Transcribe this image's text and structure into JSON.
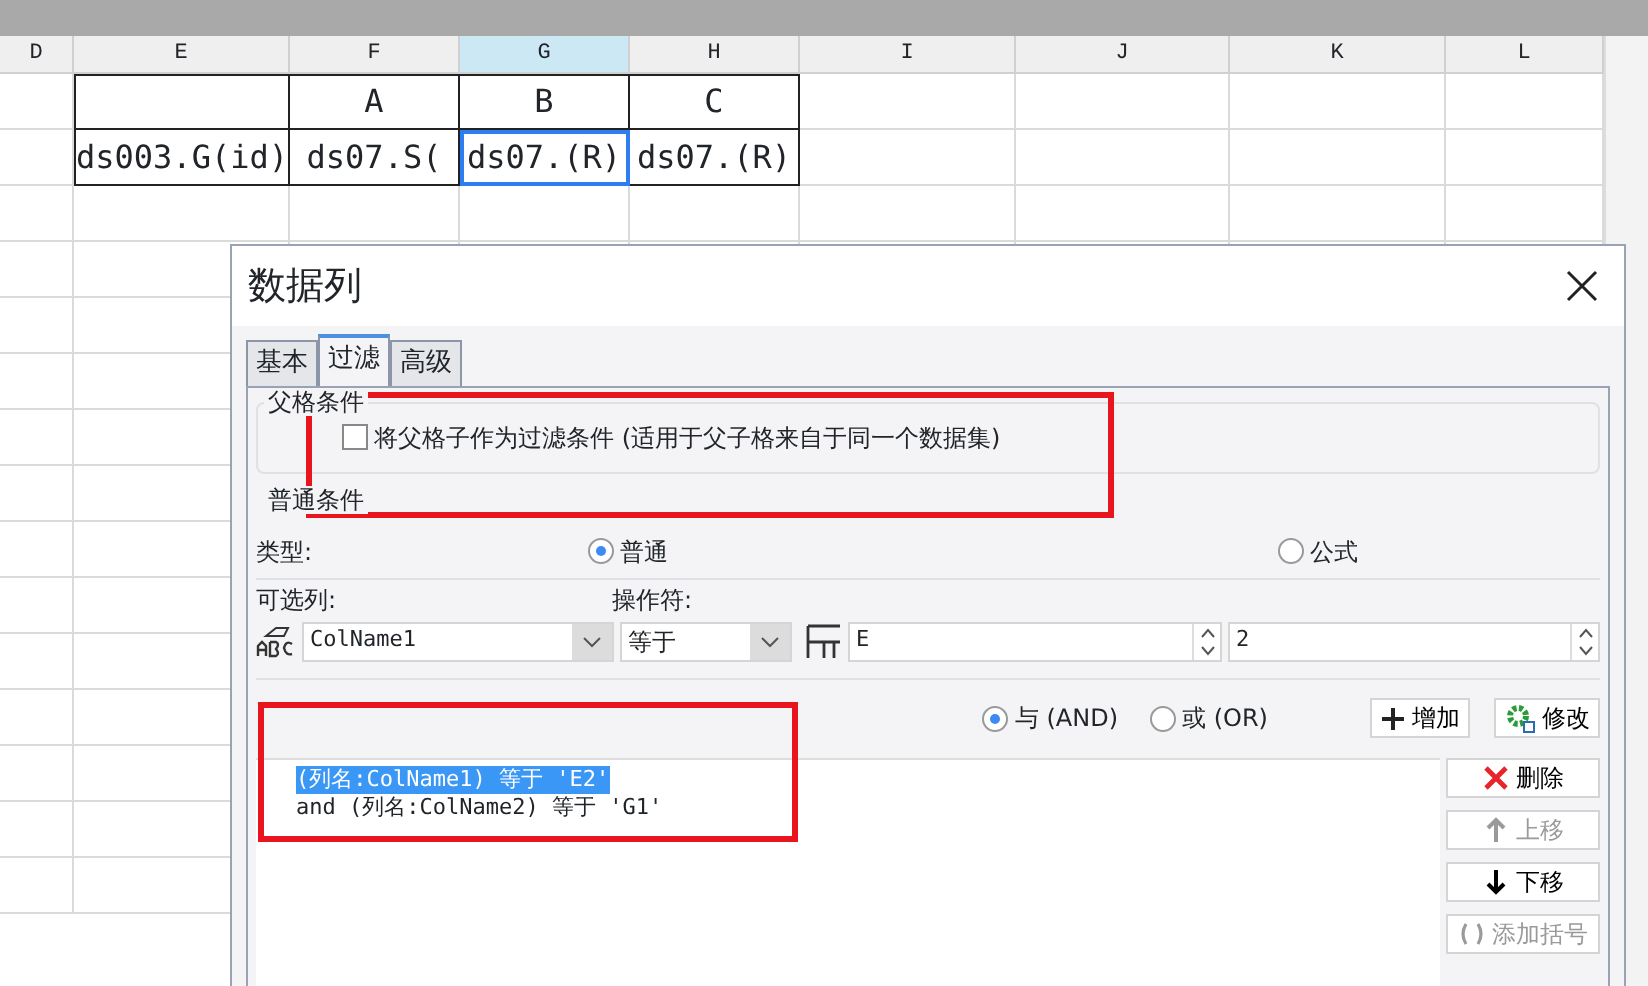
{
  "sheet": {
    "columns": [
      {
        "label": "D",
        "selected": false
      },
      {
        "label": "E",
        "selected": false
      },
      {
        "label": "F",
        "selected": false
      },
      {
        "label": "G",
        "selected": true
      },
      {
        "label": "H",
        "selected": false
      },
      {
        "label": "I",
        "selected": false
      },
      {
        "label": "J",
        "selected": false
      },
      {
        "label": "K",
        "selected": false
      },
      {
        "label": "L",
        "selected": false
      }
    ],
    "rows": [
      [
        null,
        null,
        {
          "text": "A",
          "selected": false
        },
        {
          "text": "B",
          "selected": false
        },
        {
          "text": "C",
          "selected": false
        }
      ],
      [
        null,
        {
          "text": "ds003.G(id)",
          "selected": false
        },
        {
          "text": "ds07.S(",
          "selected": false
        },
        {
          "text": "ds07.(R)",
          "selected": true
        },
        {
          "text": "ds07.(R)",
          "selected": false
        }
      ]
    ]
  },
  "dialog": {
    "title": "数据列",
    "tabs": [
      {
        "label": "基本",
        "selected": false
      },
      {
        "label": "过滤",
        "selected": true
      },
      {
        "label": "高级",
        "selected": false
      }
    ],
    "parent_group": {
      "title": "父格条件",
      "checkbox": {
        "label": "将父格子作为过滤条件 (适用于父子格来自于同一个数据集)",
        "checked": false
      }
    },
    "normal_group": {
      "title": "普通条件",
      "type_label": "类型:",
      "types": [
        {
          "label": "普通",
          "selected": true
        },
        {
          "label": "公式",
          "selected": false
        }
      ],
      "column_label": "可选列:",
      "operator_label": "操作符:",
      "column_value": "ColName1",
      "operator_value": "等于",
      "value_1": "E",
      "value_2": "2",
      "joins": [
        {
          "label": "与",
          "code": "(AND)",
          "selected": true
        },
        {
          "label": "或",
          "code": "(OR)",
          "selected": false
        }
      ],
      "add_button": "增加",
      "edit_button": "修改",
      "conditions": [
        {
          "text": "(列名:ColName1) 等于 'E2'",
          "selected": true
        },
        {
          "text": "and (列名:ColName2) 等于 'G1'",
          "selected": false
        }
      ],
      "side_buttons": [
        {
          "kind": "delete",
          "label": "删除",
          "disabled": false
        },
        {
          "kind": "up",
          "label": "上移",
          "disabled": true
        },
        {
          "kind": "down",
          "label": "下移",
          "disabled": false
        },
        {
          "kind": "paren",
          "label": "添加括号",
          "disabled": true
        }
      ]
    }
  }
}
